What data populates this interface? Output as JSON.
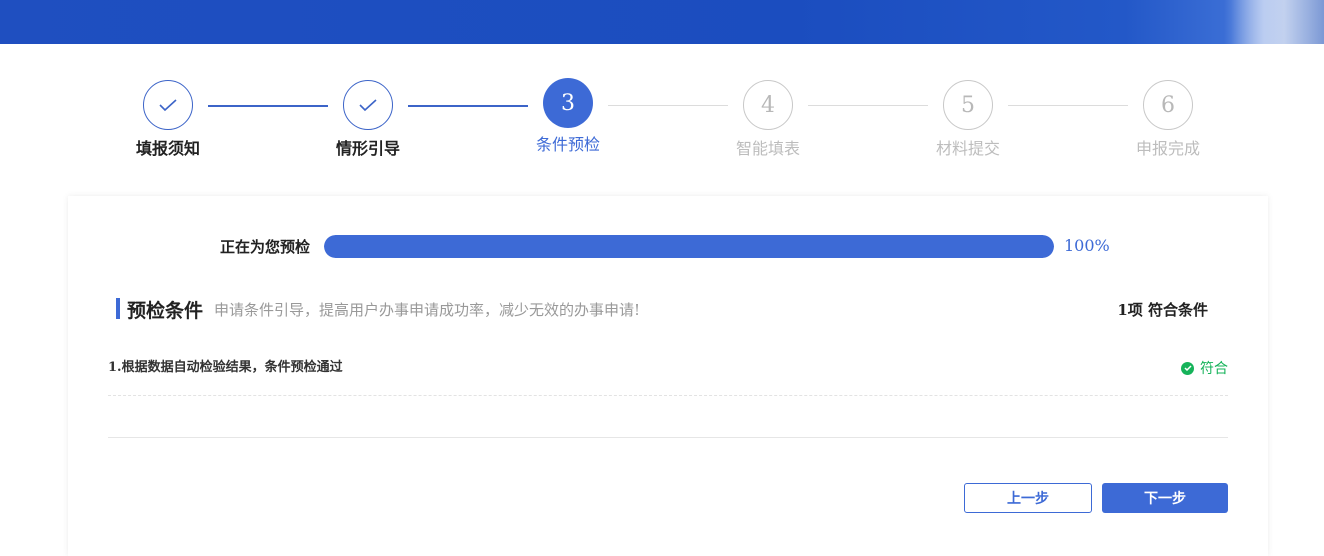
{
  "steps": [
    {
      "number": "1",
      "label": "填报须知",
      "state": "done"
    },
    {
      "number": "2",
      "label": "情形引导",
      "state": "done"
    },
    {
      "number": "3",
      "label": "条件预检",
      "state": "active"
    },
    {
      "number": "4",
      "label": "智能填表",
      "state": "todo"
    },
    {
      "number": "5",
      "label": "材料提交",
      "state": "todo"
    },
    {
      "number": "6",
      "label": "申报完成",
      "state": "todo"
    }
  ],
  "progress": {
    "label": "正在为您预检",
    "percent": 100,
    "percent_text": "100%"
  },
  "section": {
    "title": "预检条件",
    "description": "申请条件引导，提高用户办事申请成功率，减少无效的办事申请!",
    "count": "1项 符合条件"
  },
  "conditions": [
    {
      "text": "1.根据数据自动检验结果，条件预检通过",
      "status": "符合",
      "status_icon": "check-circle-icon"
    }
  ],
  "buttons": {
    "prev": "上一步",
    "next": "下一步"
  },
  "colors": {
    "primary": "#3d6ad6",
    "success": "#16b35a",
    "banner": "#1f4fc0"
  }
}
